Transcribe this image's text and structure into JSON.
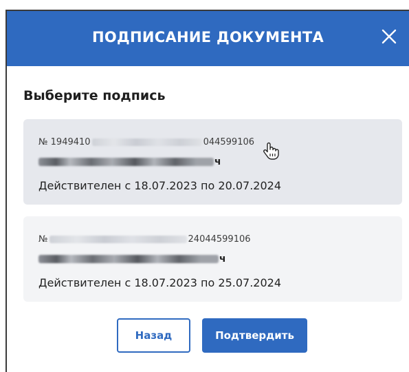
{
  "dialog": {
    "title": "ПОДПИСАНИЕ ДОКУМЕНТА",
    "close_icon": "close-icon",
    "section_title": "Выберите подпись"
  },
  "signatures": [
    {
      "serial_prefix": "№ 1949410",
      "serial_suffix": "044599106",
      "owner_suffix": "ч",
      "validity": "Действителен с 18.07.2023 по 20.07.2024"
    },
    {
      "serial_prefix": "№",
      "serial_suffix": "24044599106",
      "owner_suffix": "ч",
      "validity": "Действителен с 18.07.2023 по 25.07.2024"
    }
  ],
  "buttons": {
    "back": "Назад",
    "confirm": "Подтвердить"
  },
  "colors": {
    "accent": "#2f6ac0",
    "card_bg": "#f0f1f4"
  }
}
